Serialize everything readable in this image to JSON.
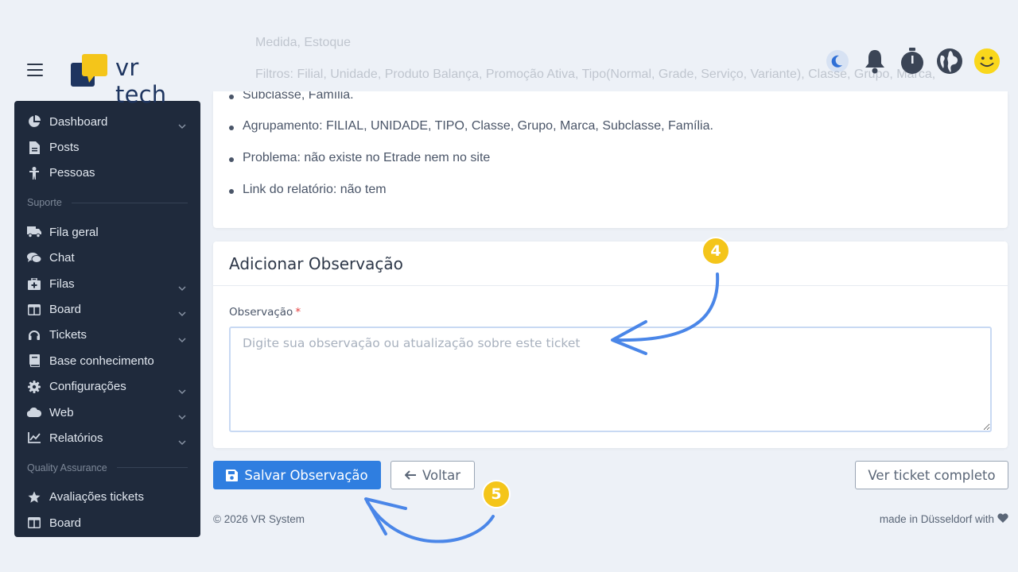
{
  "header": {
    "logo_text": "vr tech",
    "icons": [
      "moon-icon",
      "bell-icon",
      "stopwatch-icon",
      "globe-icon",
      "smiley-avatar-icon"
    ],
    "faded_lines": [
      "Medida, Estoque",
      "Filtros: Filial, Unidade, Produto Balança, Promoção Ativa, Tipo(Normal, Grade, Serviço, Variante), Classe, Grupo, Marca,"
    ]
  },
  "sidebar": {
    "items": [
      {
        "label": "Dashboard",
        "icon": "pie-chart-icon",
        "has_chevron": true
      },
      {
        "label": "Posts",
        "icon": "file-icon",
        "has_chevron": false
      },
      {
        "label": "Pessoas",
        "icon": "person-icon",
        "has_chevron": false
      }
    ],
    "section_support": "Suporte",
    "support_items": [
      {
        "label": "Fila geral",
        "icon": "truck-icon",
        "has_chevron": false
      },
      {
        "label": "Chat",
        "icon": "chat-icon",
        "has_chevron": false
      },
      {
        "label": "Filas",
        "icon": "briefcase-medical-icon",
        "has_chevron": true
      },
      {
        "label": "Board",
        "icon": "board-icon",
        "has_chevron": true
      },
      {
        "label": "Tickets",
        "icon": "headset-icon",
        "has_chevron": true
      },
      {
        "label": "Base conhecimento",
        "icon": "book-icon",
        "has_chevron": false
      },
      {
        "label": "Configurações",
        "icon": "gear-icon",
        "has_chevron": true
      },
      {
        "label": "Web",
        "icon": "cloud-icon",
        "has_chevron": true
      },
      {
        "label": "Relatórios",
        "icon": "line-chart-icon",
        "has_chevron": true
      }
    ],
    "section_qa": "Quality Assurance",
    "qa_items": [
      {
        "label": "Avaliações tickets",
        "icon": "star-icon",
        "has_chevron": false
      },
      {
        "label": "Board",
        "icon": "board-icon",
        "has_chevron": false
      }
    ]
  },
  "details": {
    "line_subclasse": "Subclasse, Família.",
    "agrupamento": "Agrupamento: FILIAL, UNIDADE, TIPO, Classe, Grupo, Marca, Subclasse, Família.",
    "problema": "Problema: não existe no Etrade nem no site",
    "link": "Link do relatório: não tem"
  },
  "form": {
    "title": "Adicionar Observação",
    "label": "Observação",
    "required_mark": "*",
    "placeholder": "Digite sua observação ou atualização sobre este ticket",
    "value": ""
  },
  "buttons": {
    "save": "Salvar Observação",
    "back": "Voltar",
    "full_ticket": "Ver ticket completo"
  },
  "footer": {
    "copyright": "© 2026 VR System",
    "made_in": "made in Düsseldorf with"
  },
  "annotations": {
    "step_4": "4",
    "step_5": "5"
  },
  "colors": {
    "sidebar_bg": "#1f2a3c",
    "primary": "#2f7ee0",
    "badge": "#f4c51a",
    "arrow": "#4a86e8"
  }
}
